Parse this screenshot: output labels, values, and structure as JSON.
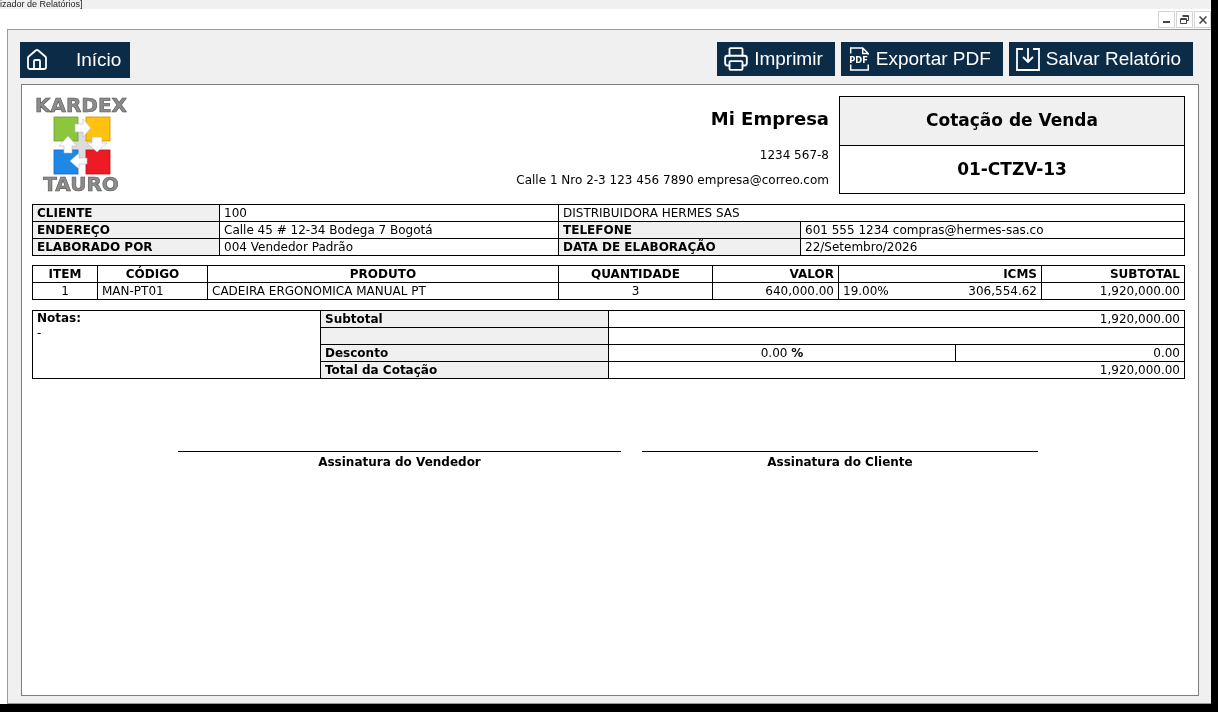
{
  "window": {
    "title": "izador de Relatórios]"
  },
  "toolbar": {
    "home_button": {
      "label": "Início"
    },
    "actions": [
      {
        "kind": "print",
        "label": "Imprimir"
      },
      {
        "kind": "pdf",
        "label": "Exportar PDF",
        "icon_text": "PDF"
      },
      {
        "kind": "save",
        "label": "Salvar Relatório"
      }
    ]
  },
  "report": {
    "logo": {
      "top_text": "KARDEX",
      "bottom_text": "TAURO"
    },
    "company": {
      "name": "Mi Empresa",
      "tax_id": "1234 567-8",
      "contact": "Calle 1 Nro 2-3 123 456 7890 empresa@correo.com"
    },
    "document": {
      "title": "Cotação de Venda",
      "number": "01-CTZV-13"
    },
    "client_info": [
      [
        {
          "kind": "label",
          "text": "CLIENTE"
        },
        {
          "kind": "value",
          "text": "100"
        },
        {
          "kind": "wide",
          "text": "DISTRIBUIDORA HERMES SAS"
        }
      ],
      [
        {
          "kind": "label",
          "text": "ENDEREÇO"
        },
        {
          "kind": "value",
          "text": "Calle 45 # 12-34 Bodega 7 Bogotá"
        },
        {
          "kind": "label",
          "text": "TELEFONE"
        },
        {
          "kind": "value",
          "text": "601 555 1234 compras@hermes-sas.co"
        }
      ],
      [
        {
          "kind": "label",
          "text": "ELABORADO POR"
        },
        {
          "kind": "value",
          "text": "004 Vendedor Padrão"
        },
        {
          "kind": "label",
          "text": "DATA DE ELABORAÇÃO"
        },
        {
          "kind": "value",
          "text": "22/Setembro/2026"
        }
      ]
    ],
    "items": {
      "columns": [
        "ITEM",
        "CÓDIGO",
        "PRODUTO",
        "QUANTIDADE",
        "VALOR",
        "ICMS",
        "SUBTOTAL"
      ],
      "rows": [
        {
          "item": "1",
          "code": "MAN-PT01",
          "product": "CADEIRA ERGONOMICA MANUAL PT",
          "quantity": "3",
          "unit_value": "640,000.00",
          "icms_rate": "19.00%",
          "icms_value": "306,554.62",
          "subtotal": "1,920,000.00"
        }
      ]
    },
    "notes": {
      "label": "Notas:",
      "text": "-"
    },
    "totals": [
      {
        "kind": "amount",
        "label": "Subtotal",
        "value": "1,920,000.00"
      },
      {
        "kind": "blank"
      },
      {
        "kind": "discount",
        "label": "Desconto",
        "percent": "0.00 **%**",
        "value": "0.00"
      },
      {
        "kind": "amount",
        "label": "Total da Cotação",
        "value": "1,920,000.00"
      }
    ],
    "signatures": [
      {
        "label": "Assinatura do Vendedor"
      },
      {
        "label": "Assinatura do Cliente"
      }
    ]
  }
}
